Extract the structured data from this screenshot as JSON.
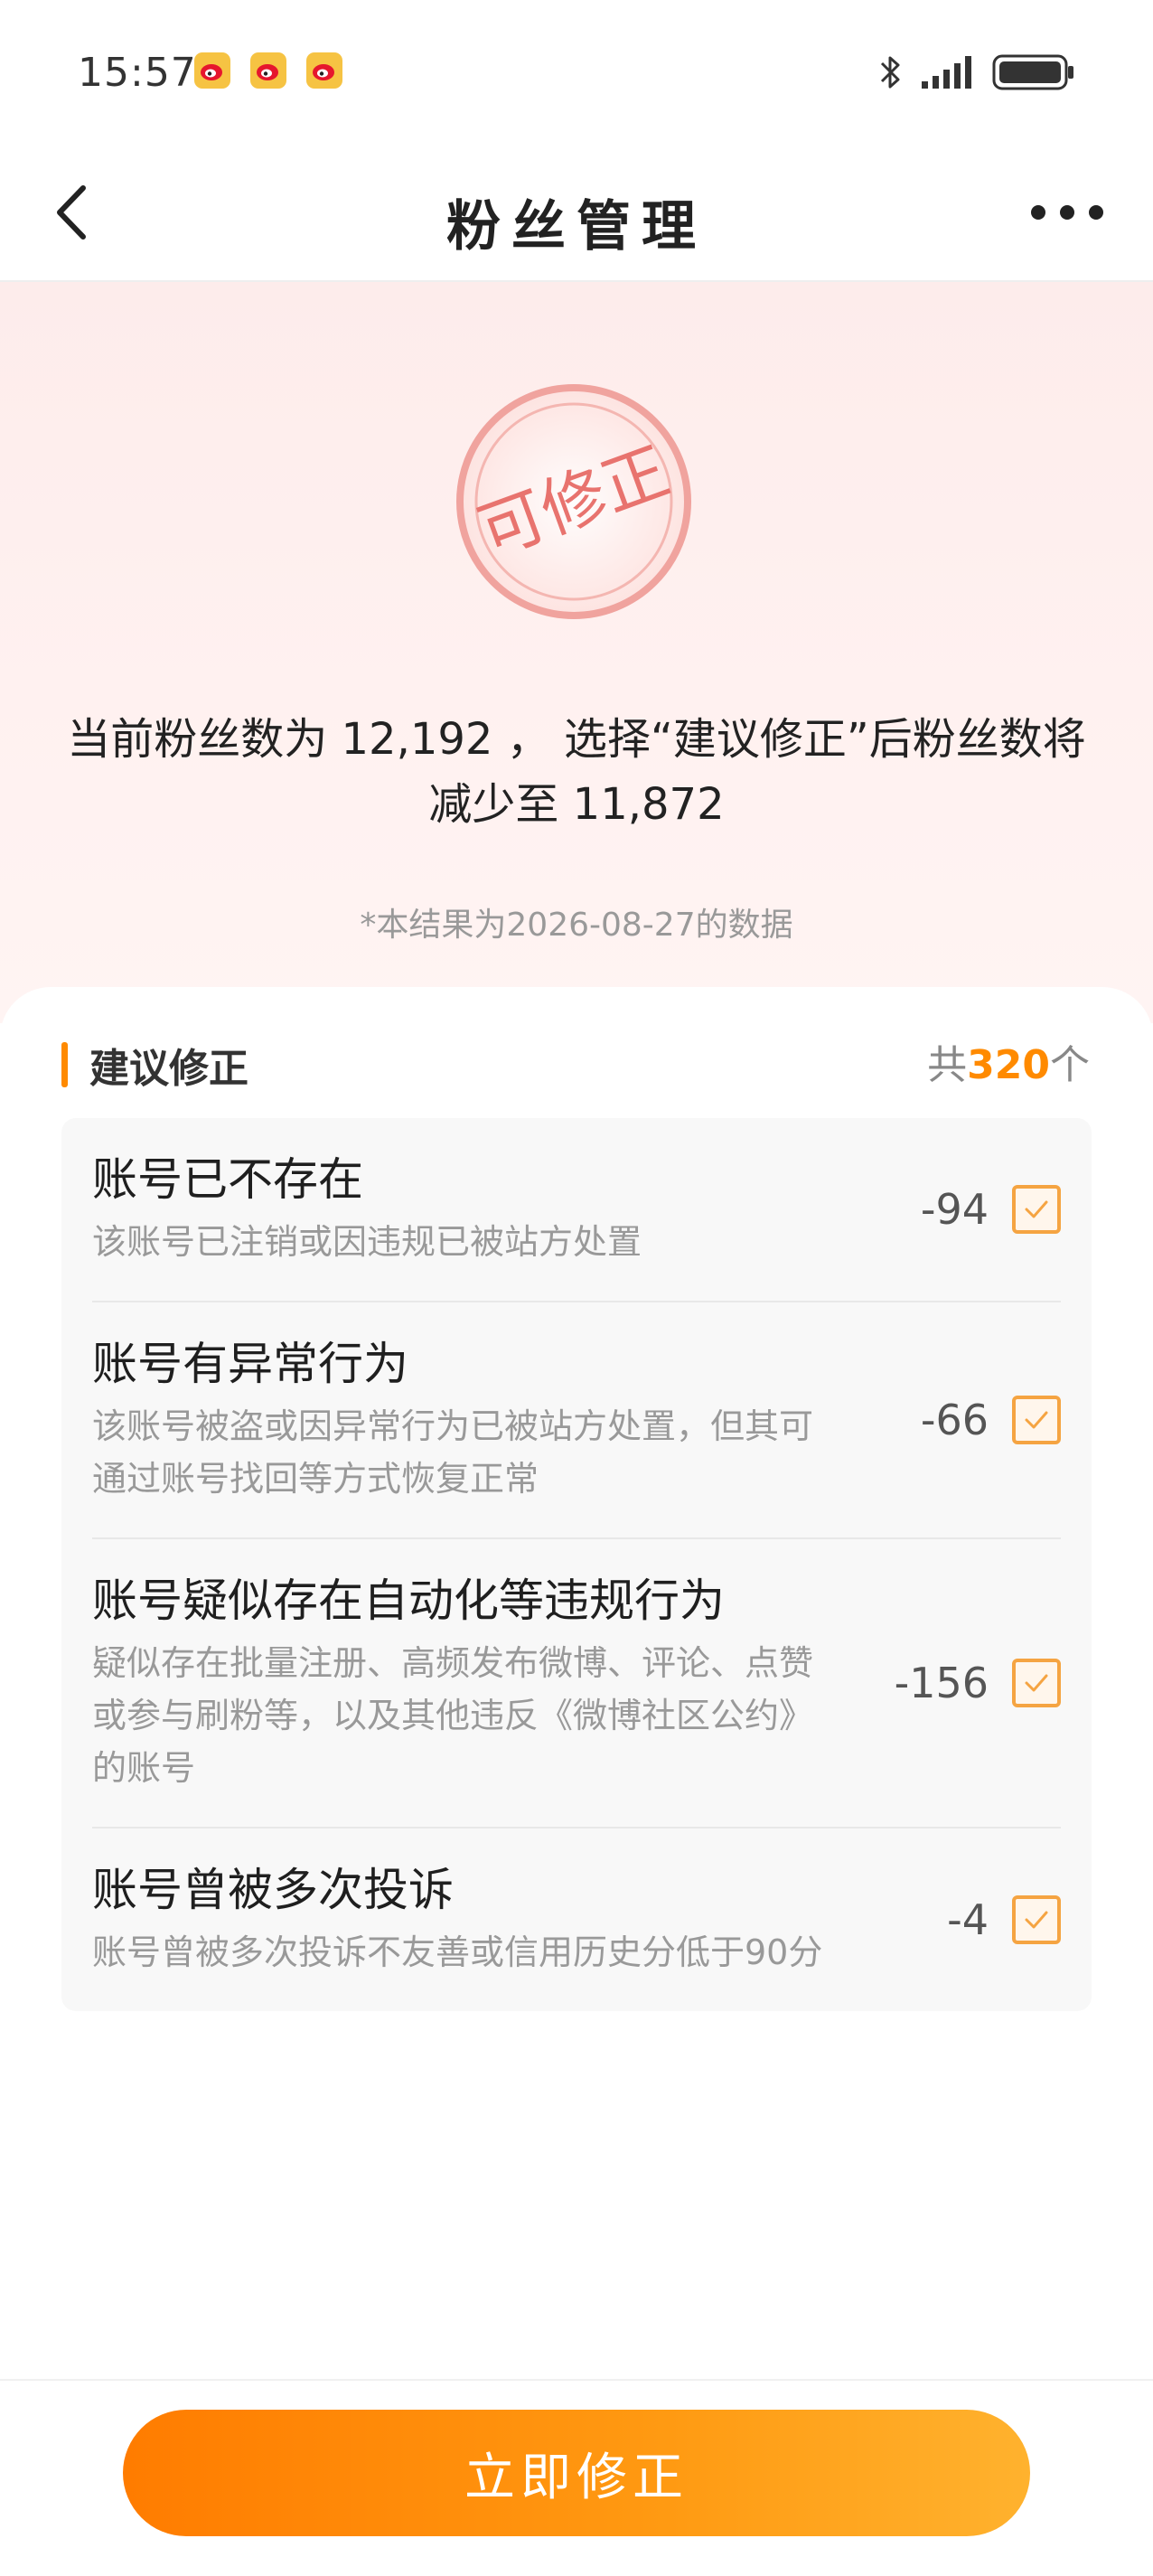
{
  "status": {
    "time": "15:57"
  },
  "nav": {
    "title": "粉丝管理"
  },
  "hero": {
    "stamp_text": "可修正",
    "summary_prefix": "当前粉丝数为 ",
    "current_fans": "12,192",
    "summary_middle": " ，  选择“建议修正”后粉丝数将减少至 ",
    "reduced_fans": "11,872",
    "note": "*本结果为2026-08-27的数据"
  },
  "section": {
    "title": "建议修正",
    "count_prefix": "共",
    "count_value": "320",
    "count_suffix": "个"
  },
  "items": [
    {
      "title": "账号已不存在",
      "desc": "该账号已注销或因违规已被站方处置",
      "value": "-94",
      "checked": true
    },
    {
      "title": "账号有异常行为",
      "desc": "该账号被盗或因异常行为已被站方处置，但其可通过账号找回等方式恢复正常",
      "value": "-66",
      "checked": true
    },
    {
      "title": "账号疑似存在自动化等违规行为",
      "desc": "疑似存在批量注册、高频发布微博、评论、点赞或参与刷粉等，以及其他违反《微博社区公约》的账号",
      "value": "-156",
      "checked": true
    },
    {
      "title": "账号曾被多次投诉",
      "desc": "账号曾被多次投诉不友善或信用历史分低于90分",
      "value": "-4",
      "checked": true
    }
  ],
  "bottom": {
    "button_label": "立即修正"
  },
  "colors": {
    "accent": "#ff8a00",
    "stamp": "#e8736e"
  }
}
